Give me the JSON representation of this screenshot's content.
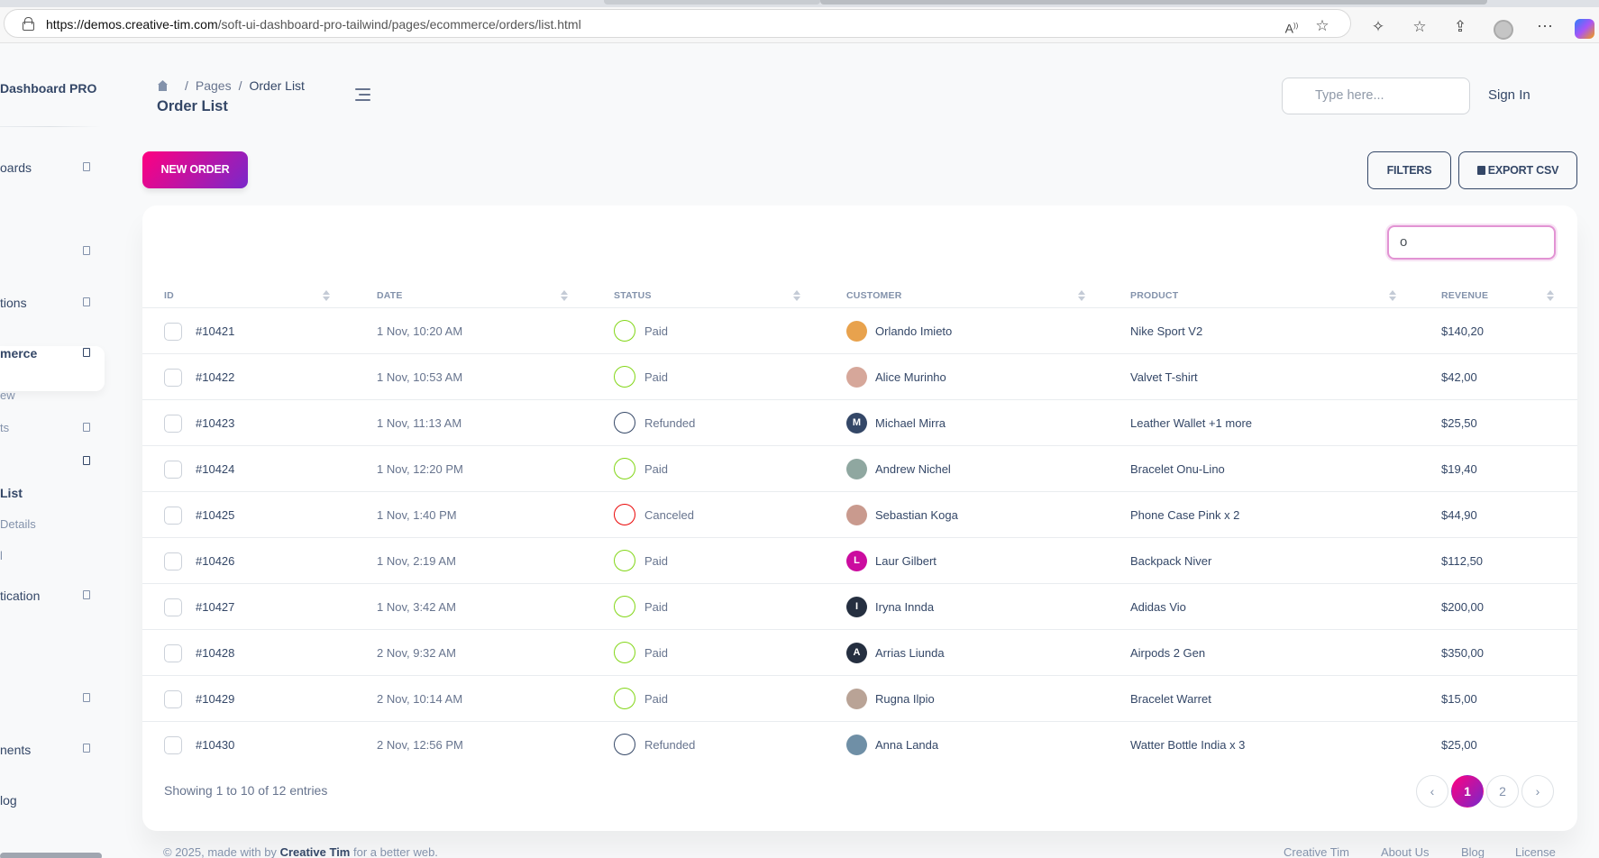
{
  "browser": {
    "url_domain": "https://demos.creative-tim.com",
    "url_path": "/soft-ui-dashboard-pro-tailwind/pages/ecommerce/orders/list.html",
    "icons": [
      "read-aloud-icon",
      "favorite-star-icon",
      "extensions-icon",
      "favorites-icon",
      "share-icon",
      "profile-icon",
      "more-icon",
      "copilot-icon"
    ]
  },
  "sidebar": {
    "brand": "Dashboard PRO",
    "items": [
      {
        "label": "oards"
      },
      {
        "label": ""
      },
      {
        "label": "tions"
      },
      {
        "label": "merce"
      },
      {
        "label": "ew"
      },
      {
        "label": "ts"
      },
      {
        "label": ""
      },
      {
        "label": "List"
      },
      {
        "label": "Details"
      },
      {
        "label": "l"
      },
      {
        "label": "tication"
      },
      {
        "label": ""
      },
      {
        "label": "nents"
      },
      {
        "label": "log"
      }
    ]
  },
  "header": {
    "breadcrumb": [
      "Pages",
      "Order List"
    ],
    "title": "Order List",
    "search_placeholder": "Type here...",
    "sign_in": "Sign In"
  },
  "toolbar": {
    "new_order": "NEW ORDER",
    "filters": "FILTERS",
    "export_csv": "EXPORT CSV"
  },
  "table": {
    "search_value": "o",
    "columns": [
      "ID",
      "DATE",
      "STATUS",
      "CUSTOMER",
      "PRODUCT",
      "REVENUE"
    ],
    "rows": [
      {
        "id": "#10421",
        "date": "1 Nov, 10:20 AM",
        "status": "Paid",
        "customer": "Orlando Imieto",
        "avatar": "",
        "product": "Nike Sport V2",
        "revenue": "$140,20"
      },
      {
        "id": "#10422",
        "date": "1 Nov, 10:53 AM",
        "status": "Paid",
        "customer": "Alice Murinho",
        "avatar": "",
        "product": "Valvet T-shirt",
        "revenue": "$42,00"
      },
      {
        "id": "#10423",
        "date": "1 Nov, 11:13 AM",
        "status": "Refunded",
        "customer": "Michael Mirra",
        "avatar": "M",
        "product": "Leather Wallet +1 more",
        "revenue": "$25,50"
      },
      {
        "id": "#10424",
        "date": "1 Nov, 12:20 PM",
        "status": "Paid",
        "customer": "Andrew Nichel",
        "avatar": "",
        "product": "Bracelet Onu-Lino",
        "revenue": "$19,40"
      },
      {
        "id": "#10425",
        "date": "1 Nov, 1:40 PM",
        "status": "Canceled",
        "customer": "Sebastian Koga",
        "avatar": "",
        "product": "Phone Case Pink x 2",
        "revenue": "$44,90"
      },
      {
        "id": "#10426",
        "date": "1 Nov, 2:19 AM",
        "status": "Paid",
        "customer": "Laur Gilbert",
        "avatar": "L",
        "product": "Backpack Niver",
        "revenue": "$112,50"
      },
      {
        "id": "#10427",
        "date": "1 Nov, 3:42 AM",
        "status": "Paid",
        "customer": "Iryna Innda",
        "avatar": "I",
        "product": "Adidas Vio",
        "revenue": "$200,00"
      },
      {
        "id": "#10428",
        "date": "2 Nov, 9:32 AM",
        "status": "Paid",
        "customer": "Arrias Liunda",
        "avatar": "A",
        "product": "Airpods 2 Gen",
        "revenue": "$350,00"
      },
      {
        "id": "#10429",
        "date": "2 Nov, 10:14 AM",
        "status": "Paid",
        "customer": "Rugna Ilpio",
        "avatar": "",
        "product": "Bracelet Warret",
        "revenue": "$15,00"
      },
      {
        "id": "#10430",
        "date": "2 Nov, 12:56 PM",
        "status": "Refunded",
        "customer": "Anna Landa",
        "avatar": "",
        "product": "Watter Bottle India x 3",
        "revenue": "$25,00"
      }
    ],
    "showing": "Showing 1 to 10 of 12 entries",
    "pagination": {
      "prev": "‹",
      "pages": [
        "1",
        "2"
      ],
      "next": "›",
      "active": "1"
    }
  },
  "footer": {
    "copyright_prefix": "© 2025, made with by",
    "brand": "Creative Tim",
    "copyright_suffix": "for a better web.",
    "links": [
      "Creative Tim",
      "About Us",
      "Blog",
      "License"
    ]
  },
  "colors": {
    "primary_gradient_start": "#7928ca",
    "primary_gradient_end": "#ff0080",
    "text_dark": "#344767",
    "text_muted": "#67748e",
    "paid": "#82d616",
    "refunded": "#344767",
    "canceled": "#ea0606"
  }
}
